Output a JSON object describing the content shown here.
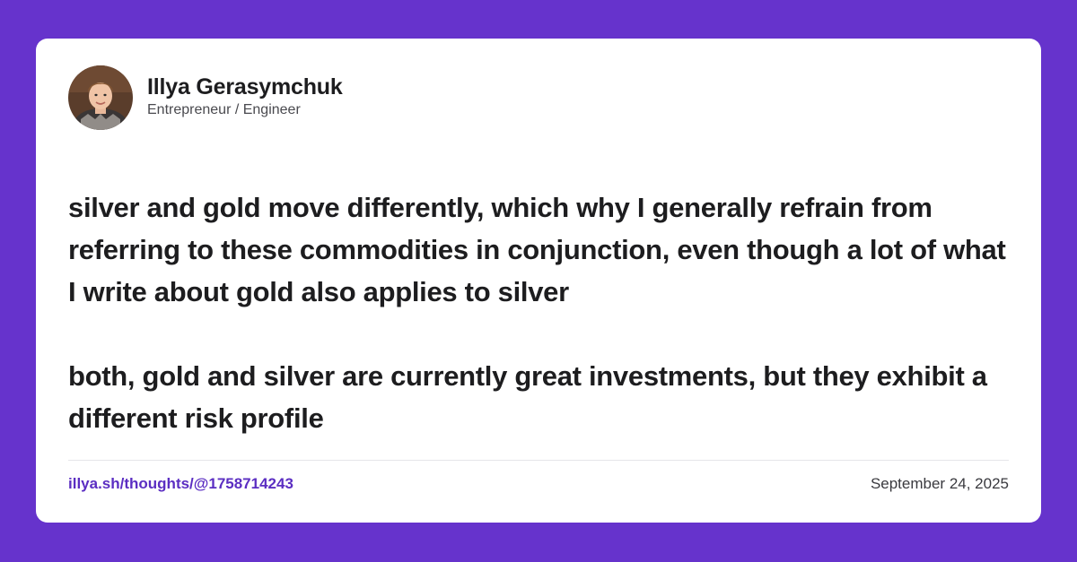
{
  "author": {
    "name": "Illya Gerasymchuk",
    "role": "Entrepreneur / Engineer"
  },
  "post": {
    "paragraphs": [
      "silver and gold move differently, which why I generally refrain from referring to these commodities in conjunction, even though a lot of what I write about gold also applies to silver",
      "both, gold and silver are currently great investments, but they exhibit a different risk profile"
    ]
  },
  "footer": {
    "permalink": "illya.sh/thoughts/@1758714243",
    "date": "September 24, 2025"
  },
  "colors": {
    "background": "#6633cc",
    "card": "#ffffff",
    "link": "#5b2ec2",
    "text": "#1d1d1f"
  }
}
